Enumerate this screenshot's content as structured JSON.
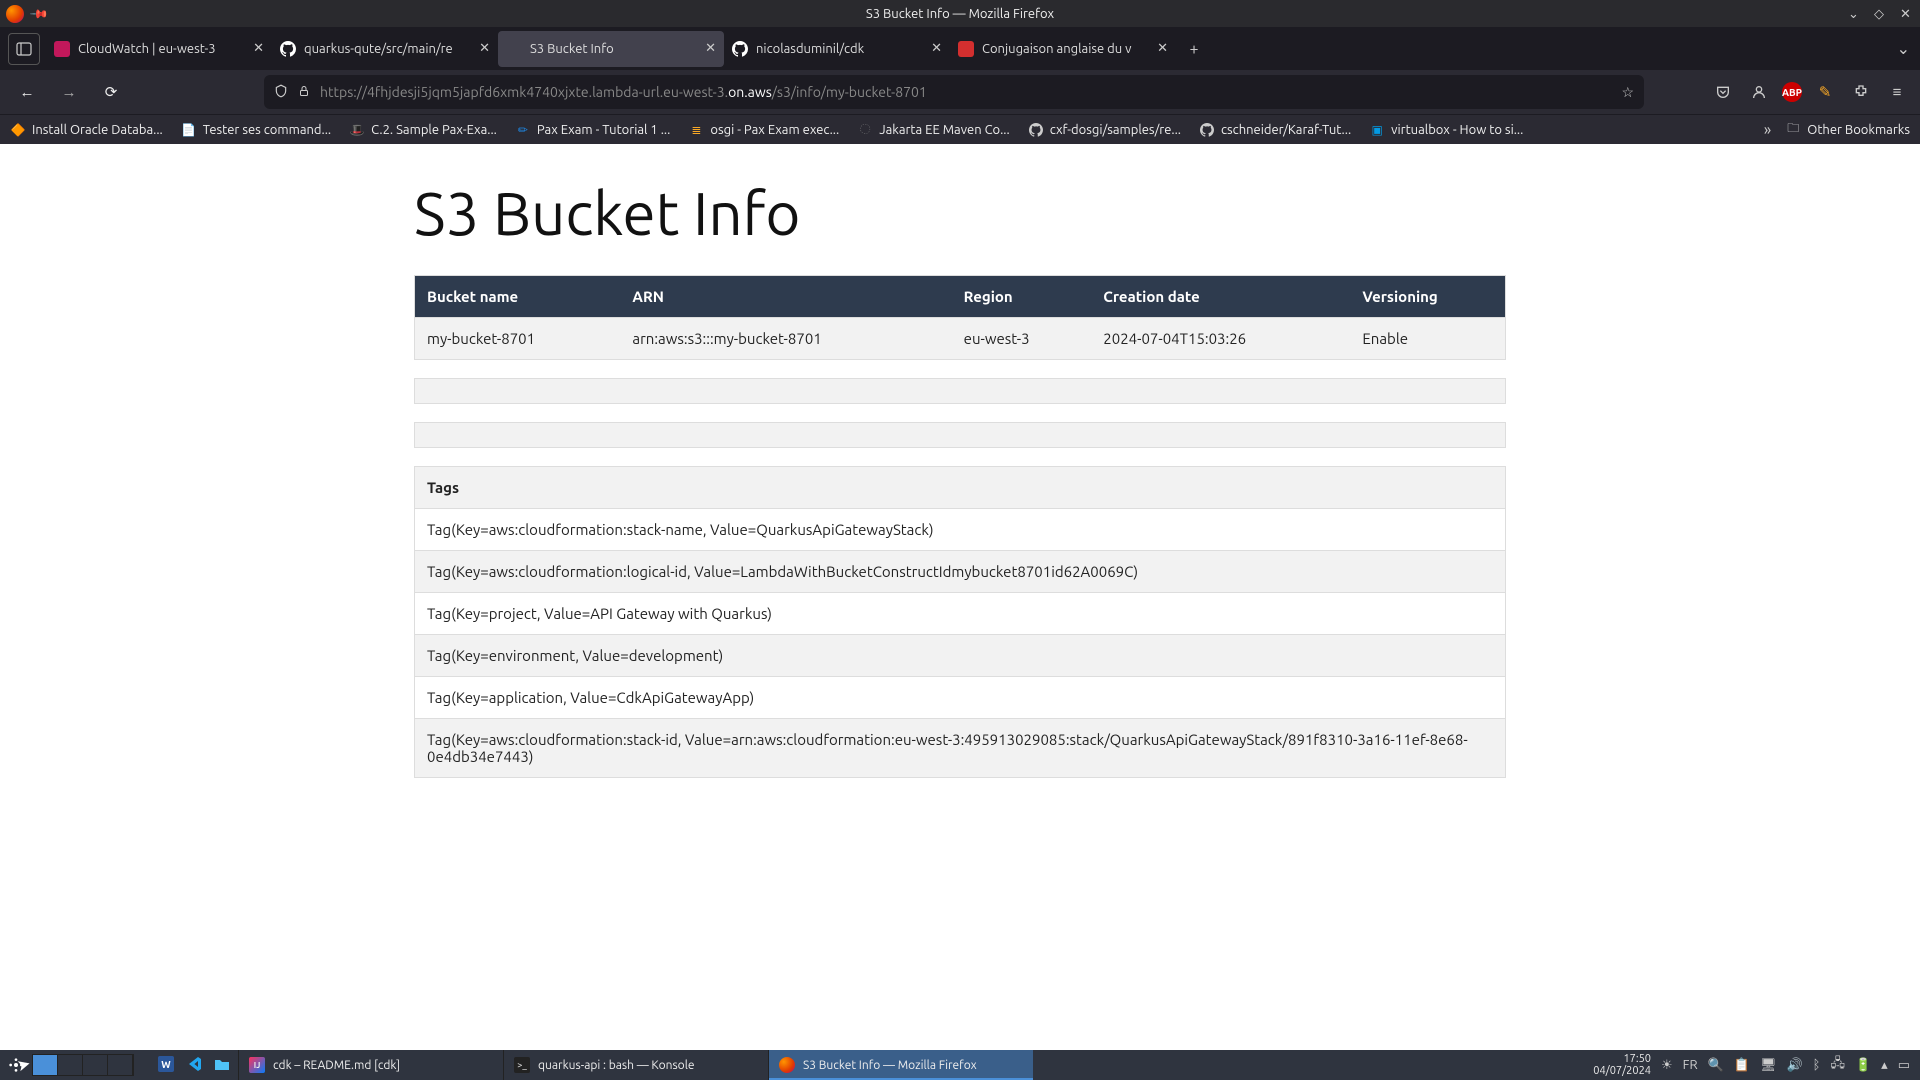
{
  "window": {
    "title": "S3 Bucket Info — Mozilla Firefox"
  },
  "tabs": [
    {
      "label": "CloudWatch | eu-west-3",
      "favicon_bg": "#c2185b",
      "favicon_text": ""
    },
    {
      "label": "quarkus-qute/src/main/re",
      "favicon_bg": "#0d1117",
      "favicon_text": ""
    },
    {
      "label": "S3 Bucket Info",
      "favicon_bg": "transparent",
      "favicon_text": "",
      "active": true
    },
    {
      "label": "nicolasduminil/cdk",
      "favicon_bg": "#0d1117",
      "favicon_text": ""
    },
    {
      "label": "Conjugaison anglaise du v",
      "favicon_bg": "#d32f2f",
      "favicon_text": ""
    }
  ],
  "url": {
    "prefix": "https://4fhjdesji5jqm5japfd6xmk4740xjxte.lambda-url.eu-west-3.",
    "base": "on.aws",
    "suffix": "/s3/info/my-bucket-8701"
  },
  "bookmarks": [
    {
      "label": "Install Oracle Databa...",
      "icon": "🔶",
      "color": ""
    },
    {
      "label": "Tester ses command...",
      "icon": "📄",
      "color": ""
    },
    {
      "label": "C.2. Sample Pax-Exa...",
      "icon": "🎩",
      "color": "#c62828"
    },
    {
      "label": "Pax Exam - Tutorial 1 ...",
      "icon": "✏",
      "color": "#1e88e5"
    },
    {
      "label": "osgi - Pax Exam exec...",
      "icon": "≣",
      "color": "#f9a825"
    },
    {
      "label": "Jakarta EE Maven Co...",
      "icon": "◌",
      "color": "#888"
    },
    {
      "label": "cxf-dosgi/samples/re...",
      "icon": "",
      "color": "#888",
      "github": true
    },
    {
      "label": "cschneider/Karaf-Tut...",
      "icon": "",
      "color": "#888",
      "github": true
    },
    {
      "label": "virtualbox - How to si...",
      "icon": "▣",
      "color": "#039be5"
    }
  ],
  "other_bookmarks_label": "Other Bookmarks",
  "page": {
    "heading": "S3 Bucket Info",
    "table_headers": [
      "Bucket name",
      "ARN",
      "Region",
      "Creation date",
      "Versioning"
    ],
    "row": {
      "bucket_name": "my-bucket-8701",
      "arn": "arn:aws:s3:::my-bucket-8701",
      "region": "eu-west-3",
      "created": "2024-07-04T15:03:26",
      "versioning": "Enable"
    },
    "tags_header": "Tags",
    "tags": [
      "Tag(Key=aws:cloudformation:stack-name, Value=QuarkusApiGatewayStack)",
      "Tag(Key=aws:cloudformation:logical-id, Value=LambdaWithBucketConstructIdmybucket8701id62A0069C)",
      "Tag(Key=project, Value=API Gateway with Quarkus)",
      "Tag(Key=environment, Value=development)",
      "Tag(Key=application, Value=CdkApiGatewayApp)",
      "Tag(Key=aws:cloudformation:stack-id, Value=arn:aws:cloudformation:eu-west-3:495913029085:stack/QuarkusApiGatewayStack/891f8310-3a16-11ef-8e68-0e4db34e7443)"
    ]
  },
  "taskbar": {
    "items": [
      {
        "label": "cdk – README.md [cdk]",
        "icon": "ij"
      },
      {
        "label": "quarkus-api : bash — Konsole",
        "icon": ">_"
      },
      {
        "label": "S3 Bucket Info — Mozilla Firefox",
        "icon": "ff",
        "active": true
      }
    ],
    "time": "17:50",
    "date": "04/07/2024",
    "lang": "FR"
  }
}
